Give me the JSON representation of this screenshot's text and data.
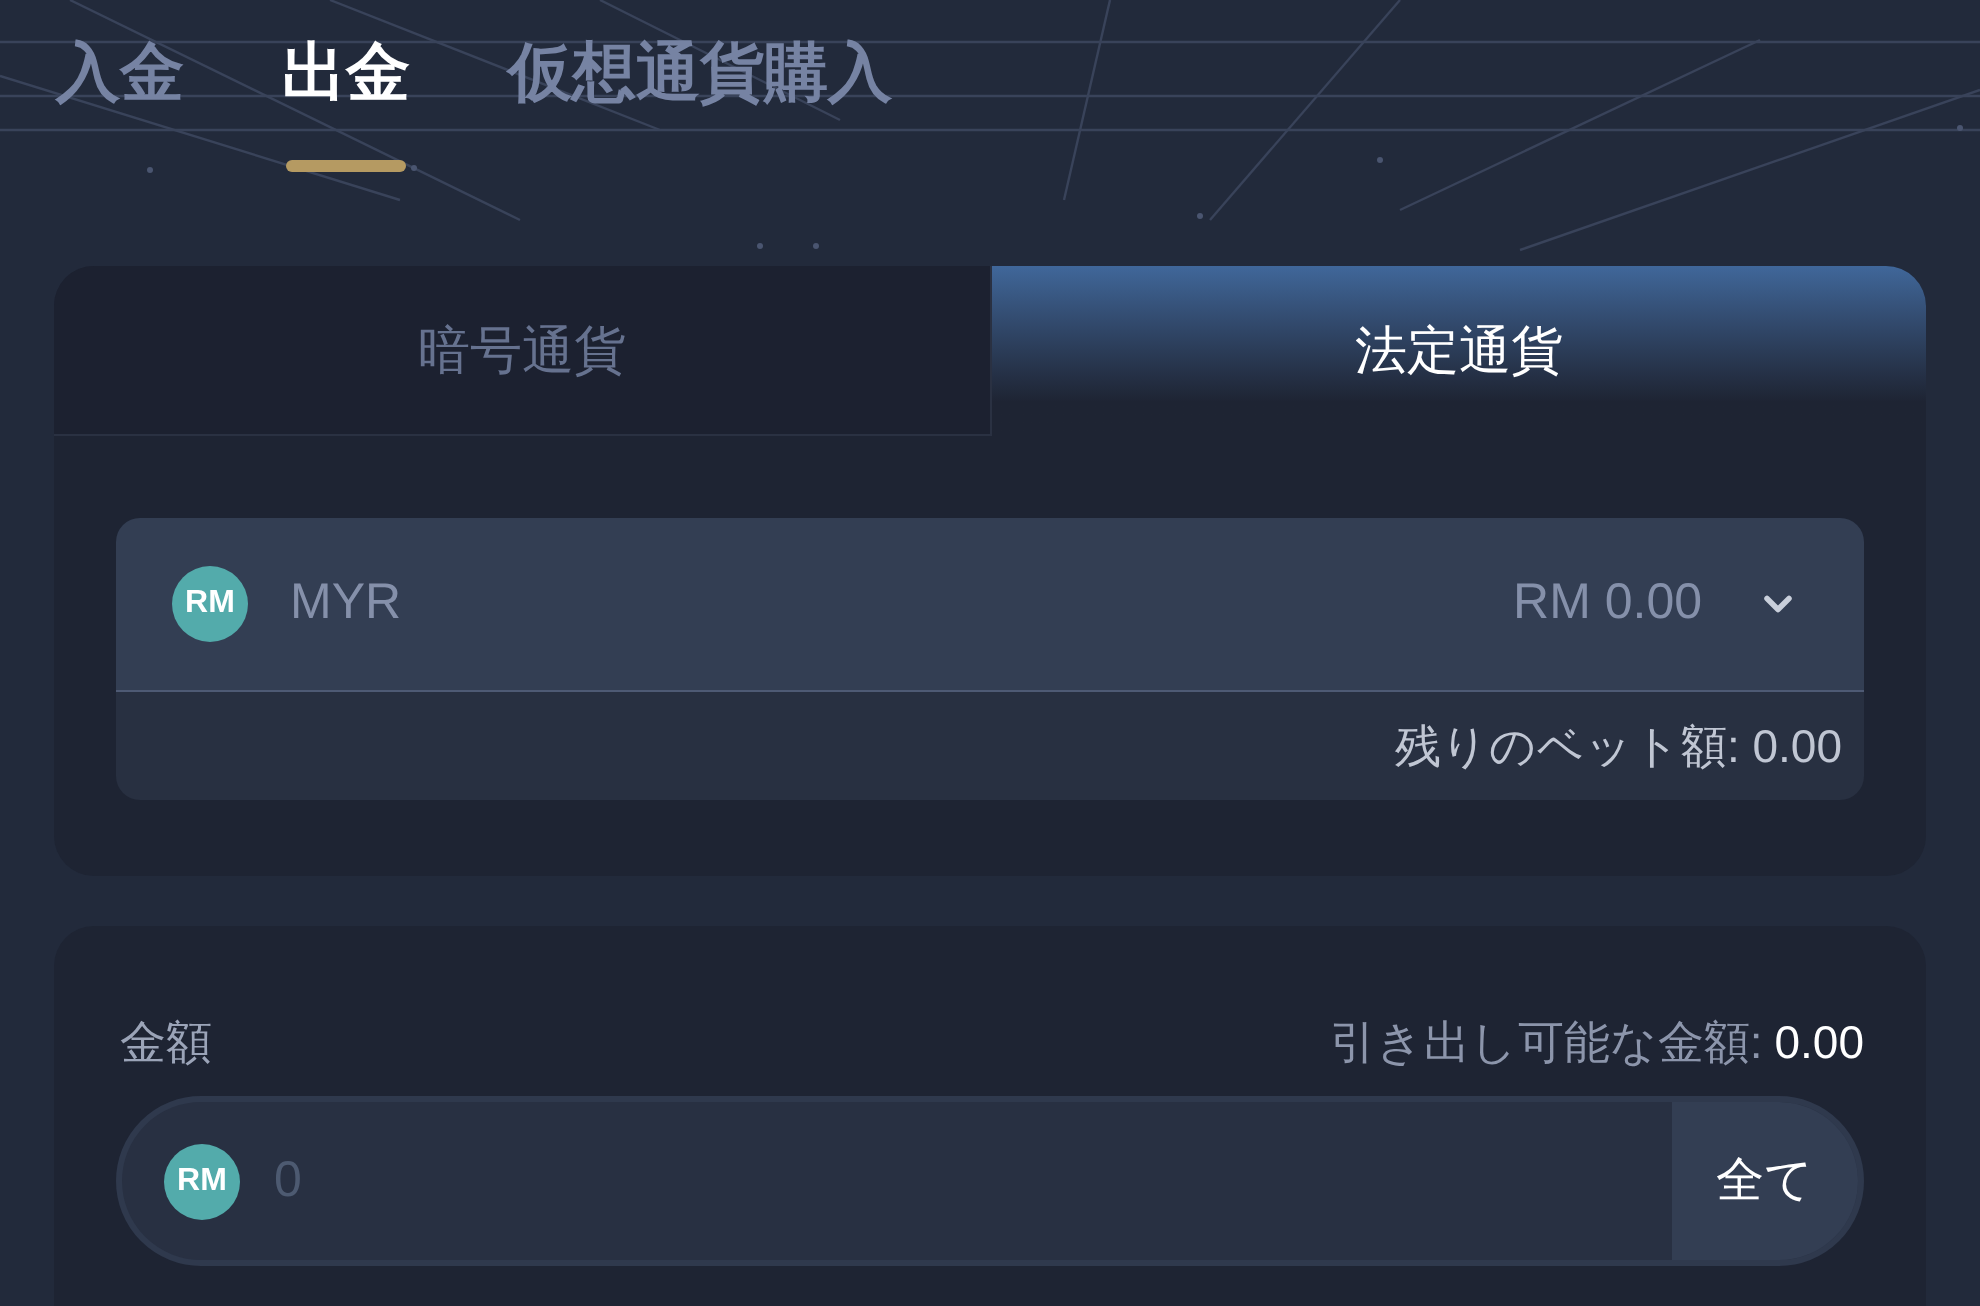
{
  "top_tabs": [
    {
      "label": "入金",
      "selected": false
    },
    {
      "label": "出金",
      "selected": true
    },
    {
      "label": "仮想通貨購入",
      "selected": false
    }
  ],
  "currency_tabs": [
    {
      "label": "暗号通貨",
      "selected": false
    },
    {
      "label": "法定通貨",
      "selected": true
    }
  ],
  "currency_select": {
    "badge": "RM",
    "currency": "MYR",
    "balance": "RM 0.00",
    "remaining_bet": "残りのベット額: 0.00"
  },
  "amount": {
    "label": "金額",
    "available_label": "引き出し可能な金額:",
    "available_value": "0.00",
    "badge": "RM",
    "placeholder": "0",
    "all_button": "全て"
  }
}
